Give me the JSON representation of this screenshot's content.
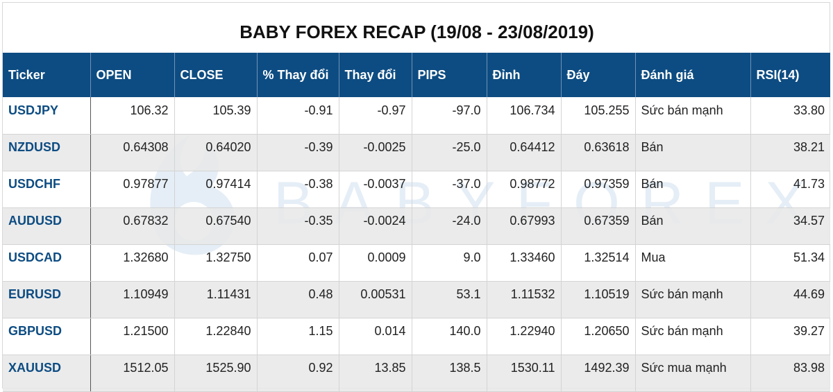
{
  "title": "BABY FOREX RECAP (19/08 - 23/08/2019)",
  "watermark": "BABYFOREX",
  "colors": {
    "header_bg": "#0d4c82",
    "ticker_text": "#0d4c82",
    "alt_row_bg": "#e8e8e8"
  },
  "columns": [
    "Ticker",
    "OPEN",
    "CLOSE",
    "% Thay đổi",
    "Thay đổi",
    "PIPS",
    "Đỉnh",
    "Đáy",
    "Đánh giá",
    "RSI(14)"
  ],
  "rows": [
    [
      "USDJPY",
      "106.32",
      "105.39",
      "-0.91",
      "-0.97",
      "-97.0",
      "106.734",
      "105.255",
      "Sức bán mạnh",
      "33.80"
    ],
    [
      "NZDUSD",
      "0.64308",
      "0.64020",
      "-0.39",
      "-0.0025",
      "-25.0",
      "0.64412",
      "0.63618",
      "Bán",
      "38.21"
    ],
    [
      "USDCHF",
      "0.97877",
      "0.97414",
      "-0.38",
      "-0.0037",
      "-37.0",
      "0.98772",
      "0.97359",
      "Bán",
      "41.73"
    ],
    [
      "AUDUSD",
      "0.67832",
      "0.67540",
      "-0.35",
      "-0.0024",
      "-24.0",
      "0.67993",
      "0.67359",
      "Bán",
      "34.57"
    ],
    [
      "USDCAD",
      "1.32680",
      "1.32750",
      "0.07",
      "0.0009",
      "9.0",
      "1.33460",
      "1.32514",
      "Mua",
      "51.34"
    ],
    [
      "EURUSD",
      "1.10949",
      "1.11431",
      "0.48",
      "0.00531",
      "53.1",
      "1.11532",
      "1.10519",
      "Sức bán mạnh",
      "44.69"
    ],
    [
      "GBPUSD",
      "1.21500",
      "1.22840",
      "1.15",
      "0.014",
      "140.0",
      "1.22940",
      "1.20650",
      "Sức bán mạnh",
      "39.27"
    ],
    [
      "XAUUSD",
      "1512.05",
      "1525.90",
      "0.92",
      "13.85",
      "138.5",
      "1530.11",
      "1492.39",
      "Sức mua mạnh",
      "83.98"
    ]
  ]
}
